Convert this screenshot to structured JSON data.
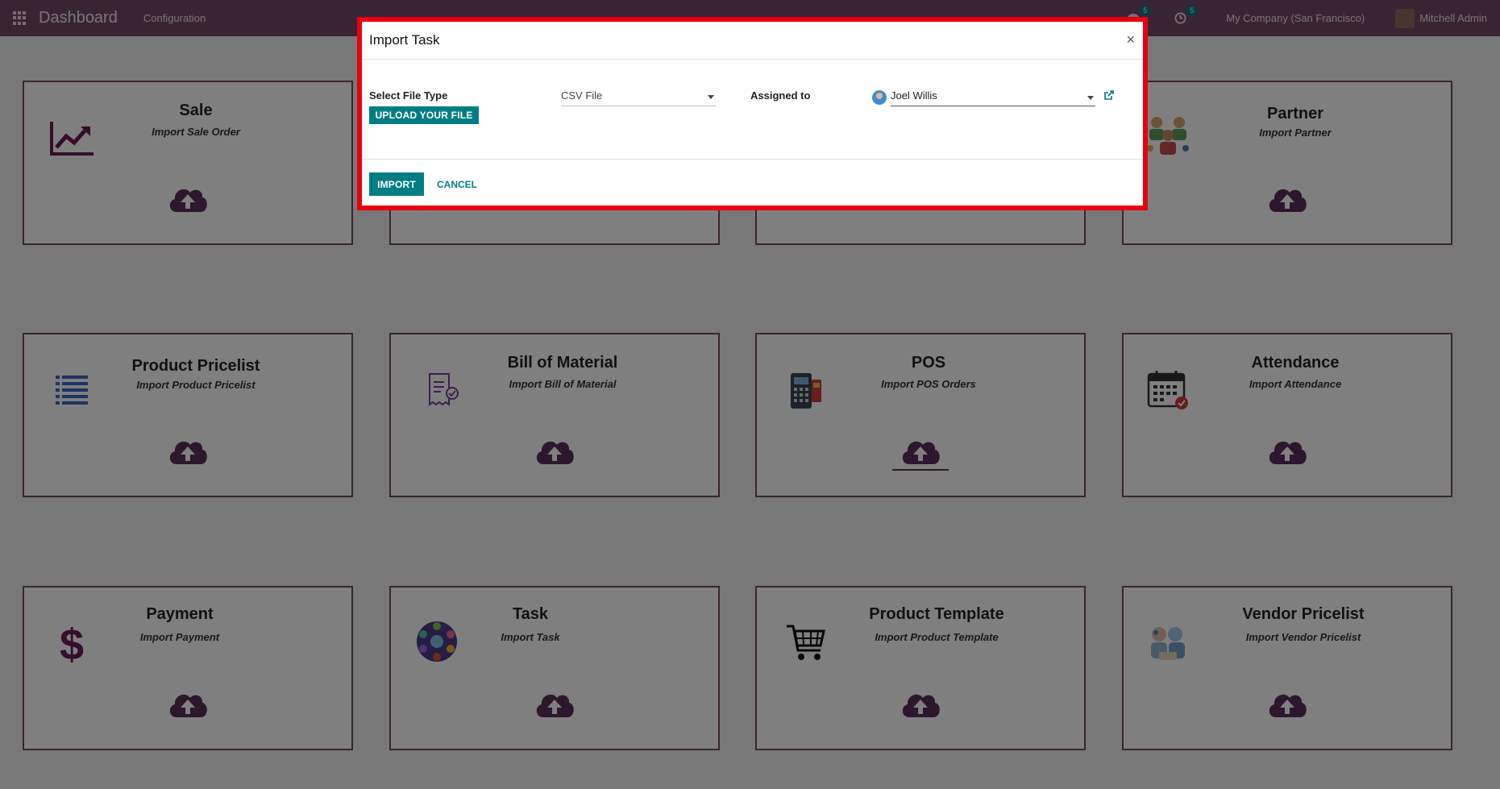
{
  "navbar": {
    "brand": "Dashboard",
    "menu": "Configuration",
    "messages_count": "5",
    "activities_count": "5",
    "company": "My Company (San Francisco)",
    "user": "Mitchell Admin"
  },
  "cards": [
    {
      "title": "Sale",
      "subtitle": "Import Sale Order",
      "icon": "chart-trend-icon"
    },
    {
      "title": "Partner",
      "subtitle": "Import Partner",
      "icon": "partner-group-icon"
    },
    {
      "title": "Product Pricelist",
      "subtitle": "Import Product Pricelist",
      "icon": "list-icon"
    },
    {
      "title": "Bill of Material",
      "subtitle": "Import Bill of Material",
      "icon": "bill-icon"
    },
    {
      "title": "POS",
      "subtitle": "Import POS Orders",
      "icon": "pos-terminal-icon"
    },
    {
      "title": "Attendance",
      "subtitle": "Import Attendance",
      "icon": "calendar-icon"
    },
    {
      "title": "Payment",
      "subtitle": "Import Payment",
      "icon": "dollar-icon"
    },
    {
      "title": "Task",
      "subtitle": "Import Task",
      "icon": "task-network-icon"
    },
    {
      "title": "Product Template",
      "subtitle": "Import Product Template",
      "icon": "cart-icon"
    },
    {
      "title": "Vendor Pricelist",
      "subtitle": "Import Vendor Pricelist",
      "icon": "vendor-icon"
    }
  ],
  "modal": {
    "title": "Import Task",
    "close": "×",
    "file_type_label": "Select File Type",
    "file_type_value": "CSV File",
    "upload_label": "UPLOAD YOUR FILE",
    "assigned_label": "Assigned to",
    "assigned_value": "Joel Willis",
    "import_label": "IMPORT",
    "cancel_label": "CANCEL"
  },
  "colors": {
    "brand": "#714B67",
    "primary": "#017e84",
    "highlight": "#e8000f"
  }
}
